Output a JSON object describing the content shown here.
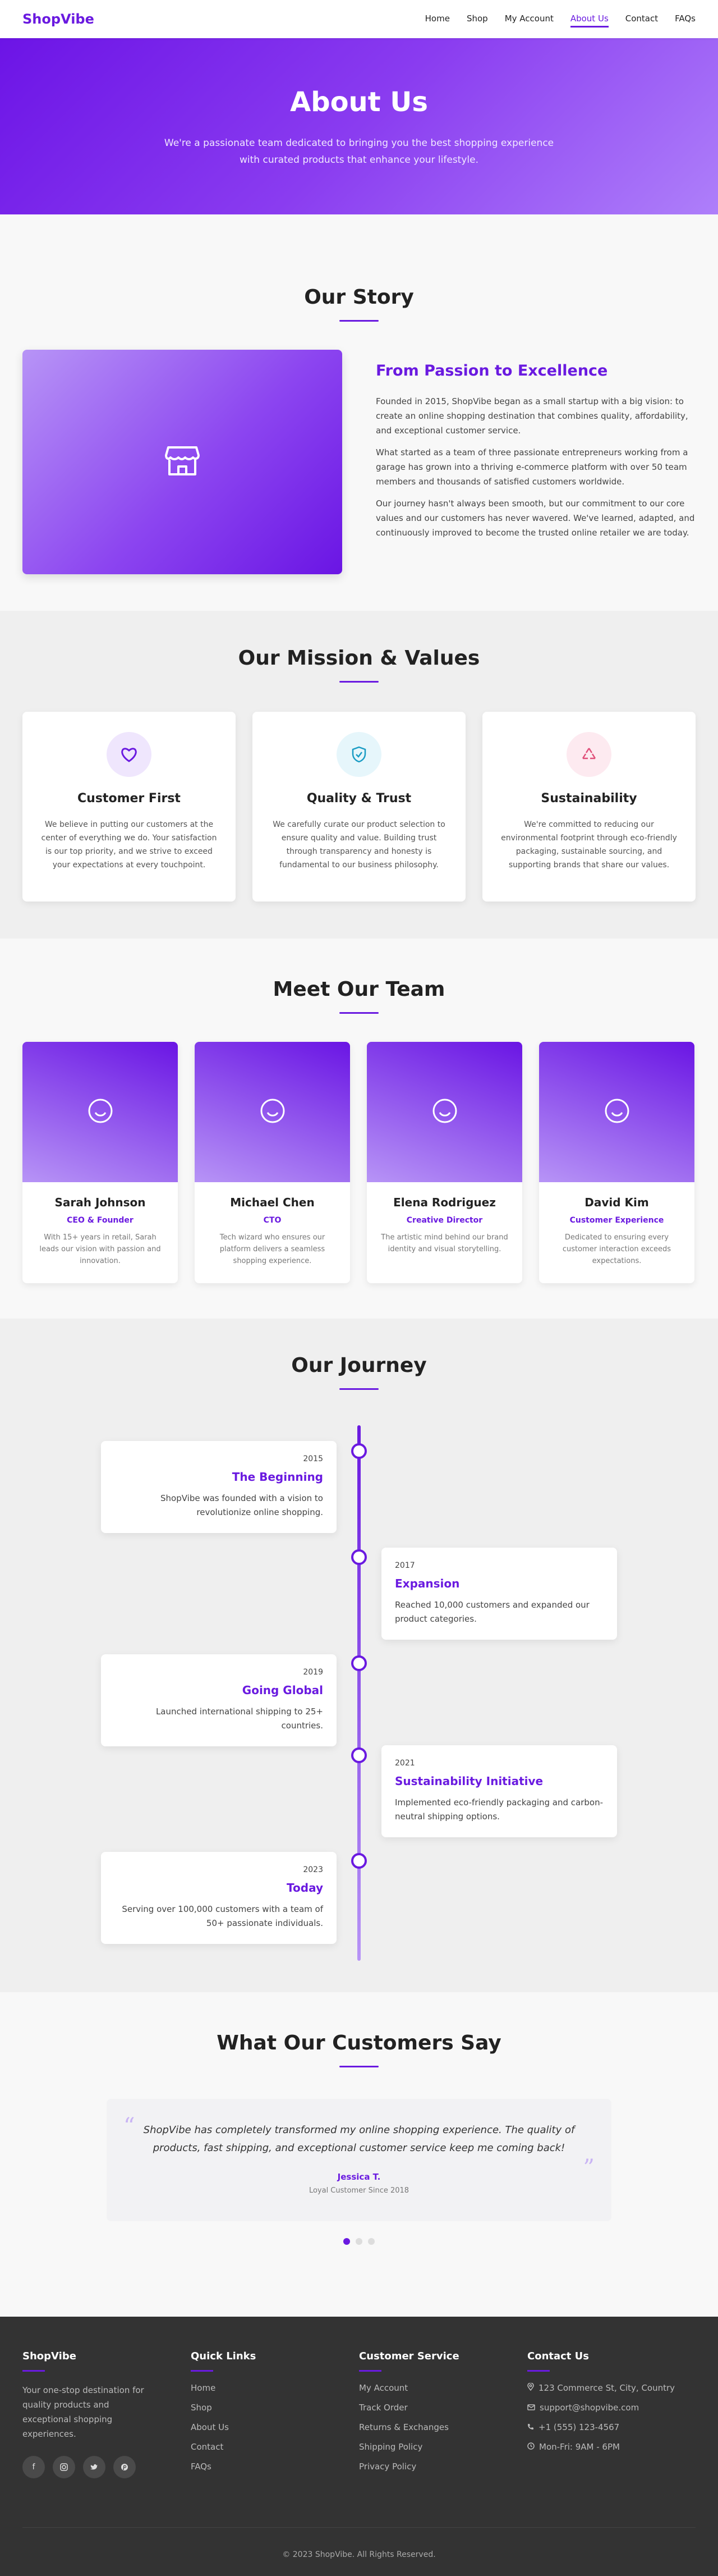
{
  "brand": {
    "logo": "ShopVibe",
    "accent": "#6a1ae0"
  },
  "nav": {
    "items": [
      "Home",
      "Shop",
      "My Account",
      "About Us",
      "Contact",
      "FAQs"
    ],
    "active": "About Us"
  },
  "hero": {
    "title": "About Us",
    "subtitle": "We're a passionate team dedicated to bringing you the best shopping experience with curated products that enhance your lifestyle."
  },
  "story": {
    "title": "Our Story",
    "image_icon": "store-icon",
    "heading": "From Passion to Excellence",
    "paragraphs": [
      "Founded in 2015, ShopVibe began as a small startup with a big vision: to create an online shopping destination that combines quality, affordability, and exceptional customer service.",
      "What started as a team of three passionate entrepreneurs working from a garage has grown into a thriving e-commerce platform with over 50 team members and thousands of satisfied customers worldwide.",
      "Our journey hasn't always been smooth, but our commitment to our core values and our customers has never wavered. We've learned, adapted, and continuously improved to become the trusted online retailer we are today."
    ]
  },
  "mission": {
    "title": "Our Mission & Values",
    "cards": [
      {
        "icon": "heart-icon",
        "title": "Customer First",
        "text": "We believe in putting our customers at the center of everything we do. Your satisfaction is our top priority, and we strive to exceed your expectations at every touchpoint."
      },
      {
        "icon": "shield-check-icon",
        "title": "Quality & Trust",
        "text": "We carefully curate our product selection to ensure quality and value. Building trust through transparency and honesty is fundamental to our business philosophy."
      },
      {
        "icon": "recycle-icon",
        "title": "Sustainability",
        "text": "We're committed to reducing our environmental footprint through eco-friendly packaging, sustainable sourcing, and supporting brands that share our values."
      }
    ]
  },
  "team": {
    "title": "Meet Our Team",
    "members": [
      {
        "name": "Sarah Johnson",
        "role": "CEO & Founder",
        "bio": "With 15+ years in retail, Sarah leads our vision with passion and innovation."
      },
      {
        "name": "Michael Chen",
        "role": "CTO",
        "bio": "Tech wizard who ensures our platform delivers a seamless shopping experience."
      },
      {
        "name": "Elena Rodriguez",
        "role": "Creative Director",
        "bio": "The artistic mind behind our brand identity and visual storytelling."
      },
      {
        "name": "David Kim",
        "role": "Customer Experience",
        "bio": "Dedicated to ensuring every customer interaction exceeds expectations."
      }
    ]
  },
  "journey": {
    "title": "Our Journey",
    "events": [
      {
        "year": "2015",
        "title": "The Beginning",
        "text": "ShopVibe was founded with a vision to revolutionize online shopping."
      },
      {
        "year": "2017",
        "title": "Expansion",
        "text": "Reached 10,000 customers and expanded our product categories."
      },
      {
        "year": "2019",
        "title": "Going Global",
        "text": "Launched international shipping to 25+ countries."
      },
      {
        "year": "2021",
        "title": "Sustainability Initiative",
        "text": "Implemented eco-friendly packaging and carbon-neutral shipping options."
      },
      {
        "year": "2023",
        "title": "Today",
        "text": "Serving over 100,000 customers with a team of 50+ passionate individuals."
      }
    ]
  },
  "testimonials": {
    "title": "What Our Customers Say",
    "quote": "ShopVibe has completely transformed my online shopping experience. The quality of products, fast shipping, and exceptional customer service keep me coming back!",
    "name": "Jessica T.",
    "since": "Loyal Customer Since 2018",
    "active_slide": 1,
    "slides": 3
  },
  "footer": {
    "brand": "ShopVibe",
    "about": "Your one-stop destination for quality products and exceptional shopping experiences.",
    "socials": [
      "facebook-icon",
      "instagram-icon",
      "twitter-icon",
      "pinterest-icon"
    ],
    "quick_links": {
      "title": "Quick Links",
      "items": [
        "Home",
        "Shop",
        "About Us",
        "Contact",
        "FAQs"
      ]
    },
    "service": {
      "title": "Customer Service",
      "items": [
        "My Account",
        "Track Order",
        "Returns & Exchanges",
        "Shipping Policy",
        "Privacy Policy"
      ]
    },
    "contact": {
      "title": "Contact Us",
      "items": [
        {
          "icon": "map-pin-icon",
          "text": "123 Commerce St, City, Country"
        },
        {
          "icon": "mail-icon",
          "text": "support@shopvibe.com"
        },
        {
          "icon": "phone-icon",
          "text": "+1 (555) 123-4567"
        },
        {
          "icon": "clock-icon",
          "text": "Mon-Fri: 9AM - 6PM"
        }
      ]
    },
    "copyright": "© 2023 ShopVibe. All Rights Reserved."
  }
}
